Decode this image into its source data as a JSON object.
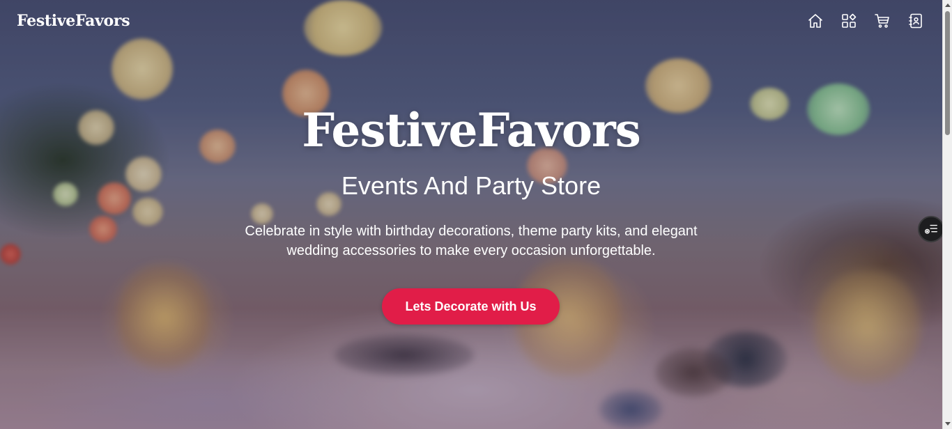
{
  "navbar": {
    "brand": "FestiveFavors",
    "icons": [
      "home-icon",
      "categories-icon",
      "cart-icon",
      "contacts-icon"
    ]
  },
  "hero": {
    "title": "FestiveFavors",
    "subtitle": "Events And Party Store",
    "description": "Celebrate in style with birthday decorations, theme party kits, and elegant wedding accessories to make every occasion unforgettable.",
    "cta_label": "Lets Decorate with Us"
  },
  "colors": {
    "accent": "#e11d48",
    "text": "#ffffff",
    "widget_bg": "#1d1d1f"
  },
  "side_widget": {
    "icon": "list-settings-icon"
  }
}
